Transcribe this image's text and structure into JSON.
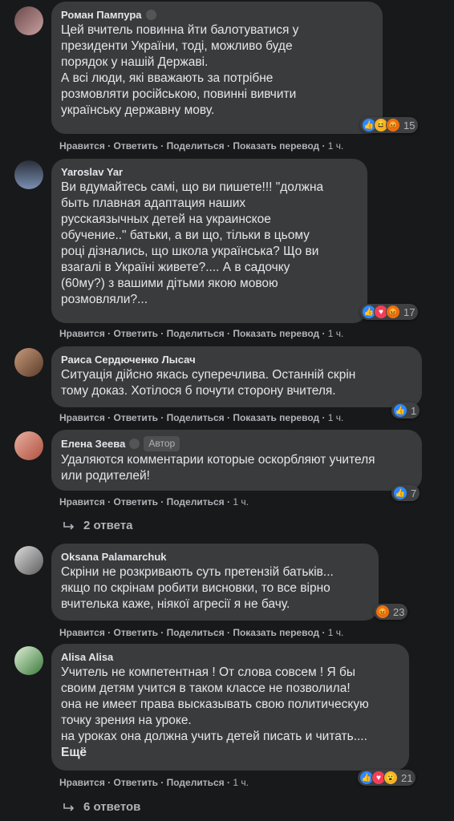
{
  "actions": {
    "like": "Нравится",
    "reply": "Ответить",
    "share": "Поделиться",
    "translate": "Показать перевод",
    "sep": " · "
  },
  "comments": [
    {
      "author": "Роман Пампура",
      "text": "Цей вчитель повинна йти балотуватися у\nпрезиденти України, тоді, можливо буде\nпорядок у нашій Державі.\nА всі люди, які вважають за потрібне\nрозмовляти російською, повинні вивчити\nукраїнську державну мову.",
      "time": "1 ч.",
      "reactions": [
        "like",
        "haha",
        "angry"
      ],
      "reaction_count": "15"
    },
    {
      "author": "Yaroslav Yar",
      "text": "Ви вдумайтесь самі, що ви пишете!!! \"должна\nбыть плавная адаптация наших\nрусскаязычных детей на украинское\nобучение..\" батьки, а ви що, тільки в цьому\nроці дізнались, що школа українська? Що ви\nвзагалі в Україні живете?.... А в садочку\n(60му?) з вашими дітьми якою мовою\nрозмовляли?...",
      "time": "1 ч.",
      "reactions": [
        "like",
        "love",
        "angry"
      ],
      "reaction_count": "17"
    },
    {
      "author": "Раиса Сердюченко Лысач",
      "text": "Ситуація дійсно якась суперечлива. Останній скрін\nтому доказ. Хотілося б почути сторону вчителя.",
      "time": "1 ч.",
      "reactions": [
        "like"
      ],
      "reaction_count": "1"
    },
    {
      "author": "Елена Зеева",
      "author_tag": "Автор",
      "text": "Удаляются комментарии которые оскорбляют учителя\nили родителей!",
      "time": "1 ч.",
      "reactions": [
        "like"
      ],
      "reaction_count": "7",
      "replies": "2 ответа"
    },
    {
      "author": "Oksana Palamarchuk",
      "text": "Скріни не розкривають суть претензій батьків...\nякщо по скрінам робити висновки, то все вірно\nвчителька каже, ніякої агресії я не бачу.",
      "time": "1 ч.",
      "reactions": [
        "angry"
      ],
      "reaction_count": "23"
    },
    {
      "author": "Alisa Alisa",
      "text": "Учитель не компетентная ! От слова совсем ! Я бы\nсвоим детям учится в таком классе не позволила!\nона не имеет права высказывать свою политическую\nточку зрения на уроке.\nна уроках она должна учить детей писать и читать....",
      "more": "Ещё",
      "time": "1 ч.",
      "reactions": [
        "like",
        "love",
        "wow"
      ],
      "reaction_count": "21",
      "replies": "6 ответов"
    }
  ]
}
